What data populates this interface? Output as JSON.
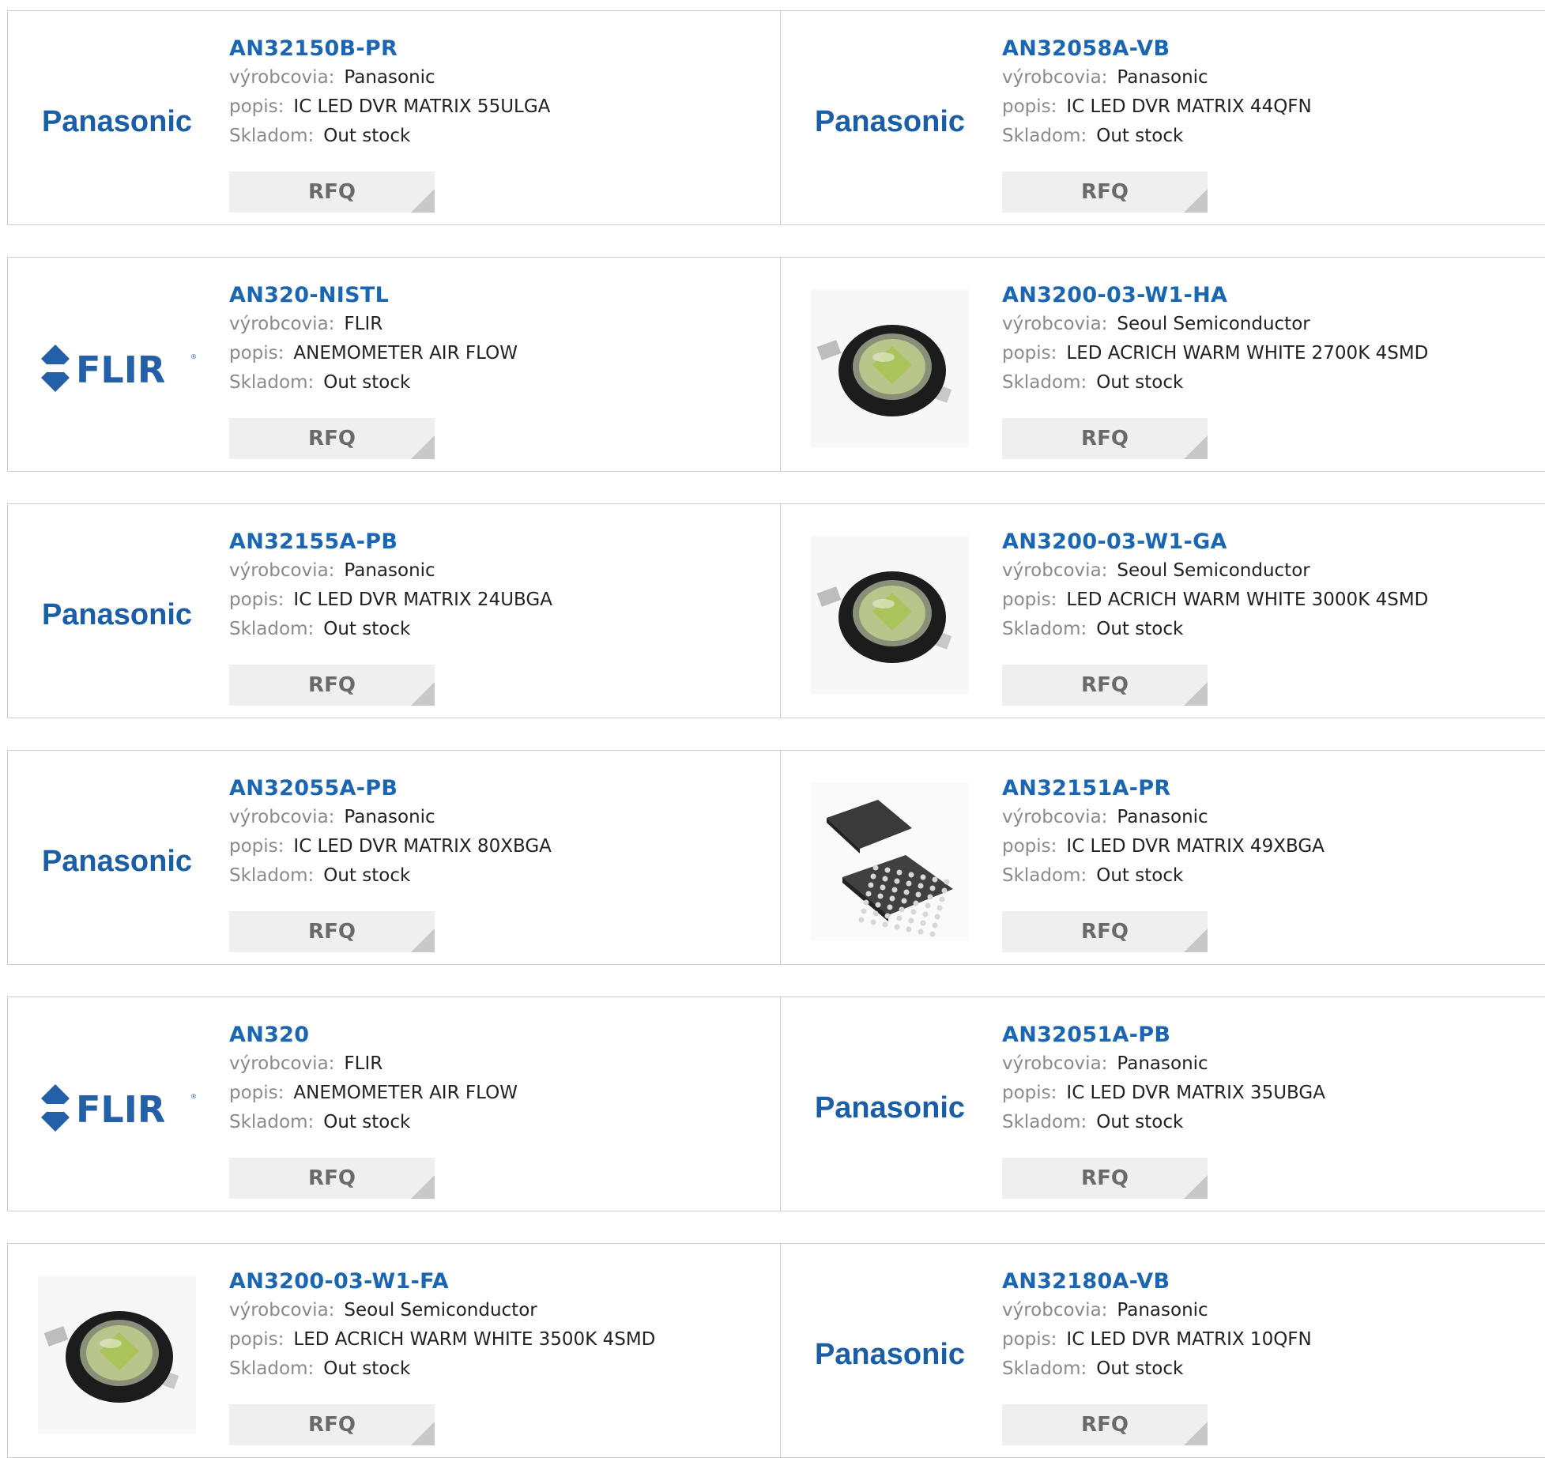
{
  "labels": {
    "manufacturer": "výrobcovia:",
    "description": "popis:",
    "stock": "Skladom:",
    "rfq": "RFQ"
  },
  "colors": {
    "link": "#1a66b3",
    "label": "#8a8a8a",
    "border": "#cfcfcf",
    "button_bg": "#efefef",
    "panasonic_blue": "#1a5ea8",
    "flir_blue": "#2460a8"
  },
  "rows": [
    {
      "cells": [
        {
          "part": "AN32150B-PR",
          "manufacturer": "Panasonic",
          "description": "IC LED DVR MATRIX 55ULGA",
          "stock": "Out stock",
          "image": "panasonic-logo",
          "logo_text": "Panasonic"
        },
        {
          "part": "AN32058A-VB",
          "manufacturer": "Panasonic",
          "description": "IC LED DVR MATRIX 44QFN",
          "stock": "Out stock",
          "image": "panasonic-logo",
          "logo_text": "Panasonic"
        }
      ]
    },
    {
      "cells": [
        {
          "part": "AN320-NISTL",
          "manufacturer": "FLIR",
          "description": "ANEMOMETER AIR FLOW",
          "stock": "Out stock",
          "image": "flir-logo",
          "logo_text": "FLIR"
        },
        {
          "part": "AN3200-03-W1-HA",
          "manufacturer": "Seoul Semiconductor",
          "description": "LED ACRICH WARM WHITE 2700K 4SMD",
          "stock": "Out stock",
          "image": "led-photo"
        }
      ]
    },
    {
      "cells": [
        {
          "part": "AN32155A-PB",
          "manufacturer": "Panasonic",
          "description": "IC LED DVR MATRIX 24UBGA",
          "stock": "Out stock",
          "image": "panasonic-logo",
          "logo_text": "Panasonic"
        },
        {
          "part": "AN3200-03-W1-GA",
          "manufacturer": "Seoul Semiconductor",
          "description": "LED ACRICH WARM WHITE 3000K 4SMD",
          "stock": "Out stock",
          "image": "led-photo"
        }
      ]
    },
    {
      "cells": [
        {
          "part": "AN32055A-PB",
          "manufacturer": "Panasonic",
          "description": "IC LED DVR MATRIX 80XBGA",
          "stock": "Out stock",
          "image": "panasonic-logo",
          "logo_text": "Panasonic"
        },
        {
          "part": "AN32151A-PR",
          "manufacturer": "Panasonic",
          "description": "IC LED DVR MATRIX 49XBGA",
          "stock": "Out stock",
          "image": "bga-chip-photo"
        }
      ]
    },
    {
      "cells": [
        {
          "part": "AN320",
          "manufacturer": "FLIR",
          "description": "ANEMOMETER AIR FLOW",
          "stock": "Out stock",
          "image": "flir-logo",
          "logo_text": "FLIR"
        },
        {
          "part": "AN32051A-PB",
          "manufacturer": "Panasonic",
          "description": "IC LED DVR MATRIX 35UBGA",
          "stock": "Out stock",
          "image": "panasonic-logo",
          "logo_text": "Panasonic"
        }
      ]
    },
    {
      "cells": [
        {
          "part": "AN3200-03-W1-FA",
          "manufacturer": "Seoul Semiconductor",
          "description": "LED ACRICH WARM WHITE 3500K 4SMD",
          "stock": "Out stock",
          "image": "led-photo"
        },
        {
          "part": "AN32180A-VB",
          "manufacturer": "Panasonic",
          "description": "IC LED DVR MATRIX 10QFN",
          "stock": "Out stock",
          "image": "panasonic-logo",
          "logo_text": "Panasonic"
        }
      ]
    }
  ]
}
